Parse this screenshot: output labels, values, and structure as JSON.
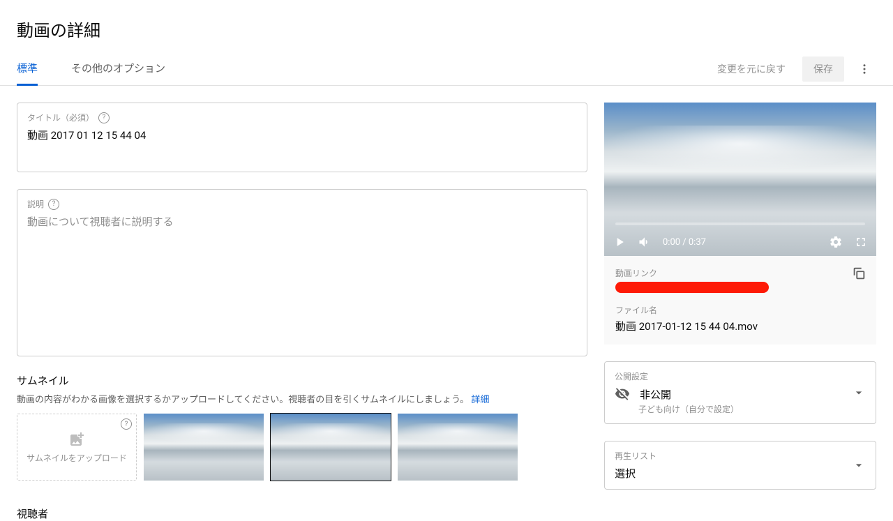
{
  "page_title": "動画の詳細",
  "tabs": {
    "standard": "標準",
    "more_options": "その他のオプション"
  },
  "actions": {
    "revert": "変更を元に戻す",
    "save": "保存"
  },
  "title_field": {
    "label": "タイトル（必須）",
    "value": "動画 2017 01 12 15 44 04"
  },
  "description_field": {
    "label": "説明",
    "placeholder": "動画について視聴者に説明する"
  },
  "thumbnail_section": {
    "heading": "サムネイル",
    "subtext": "動画の内容がわかる画像を選択するかアップロードしてください。視聴者の目を引くサムネイルにしましょう。 ",
    "learn_more": "詳細",
    "upload_label": "サムネイルをアップロード"
  },
  "player": {
    "time": "0:00 / 0:37"
  },
  "info_card": {
    "link_label": "動画リンク",
    "filename_label": "ファイル名",
    "filename_value": "動画 2017-01-12 15 44 04.mov"
  },
  "visibility": {
    "label": "公開設定",
    "value": "非公開",
    "sub": "子ども向け（自分で設定）"
  },
  "playlist": {
    "label": "再生リスト",
    "value": "選択"
  },
  "bottom_cut": "視聴者"
}
